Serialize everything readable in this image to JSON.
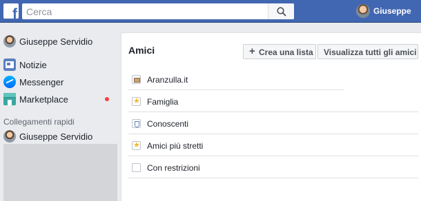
{
  "header": {
    "logo": "f",
    "search_placeholder": "Cerca",
    "search_icon": "search-icon",
    "user_name": "Giuseppe"
  },
  "sidebar": {
    "profile_name": "Giuseppe Servidio",
    "items": [
      {
        "label": "Notizie",
        "icon": "newsfeed-icon"
      },
      {
        "label": "Messenger",
        "icon": "messenger-icon"
      },
      {
        "label": "Marketplace",
        "icon": "marketplace-icon",
        "badge_color": "#fa3e3e"
      }
    ],
    "shortcuts_title": "Collegamenti rapidi",
    "shortcuts": [
      {
        "label": "Giuseppe Servidio"
      }
    ]
  },
  "main": {
    "title": "Amici",
    "create_list_label": "Crea una lista",
    "view_all_label": "Visualizza tutti gli amici",
    "lists": [
      {
        "label": "Aranzulla.it",
        "icon": "work-icon"
      },
      {
        "label": "Famiglia",
        "icon": "star-icon"
      },
      {
        "label": "Conoscenti",
        "icon": "acquaintances-icon"
      },
      {
        "label": "Amici più stretti",
        "icon": "star-icon"
      },
      {
        "label": "Con restrizioni",
        "icon": "restricted-icon"
      }
    ]
  },
  "colors": {
    "brand": "#4267b2",
    "background": "#e9ebee"
  }
}
